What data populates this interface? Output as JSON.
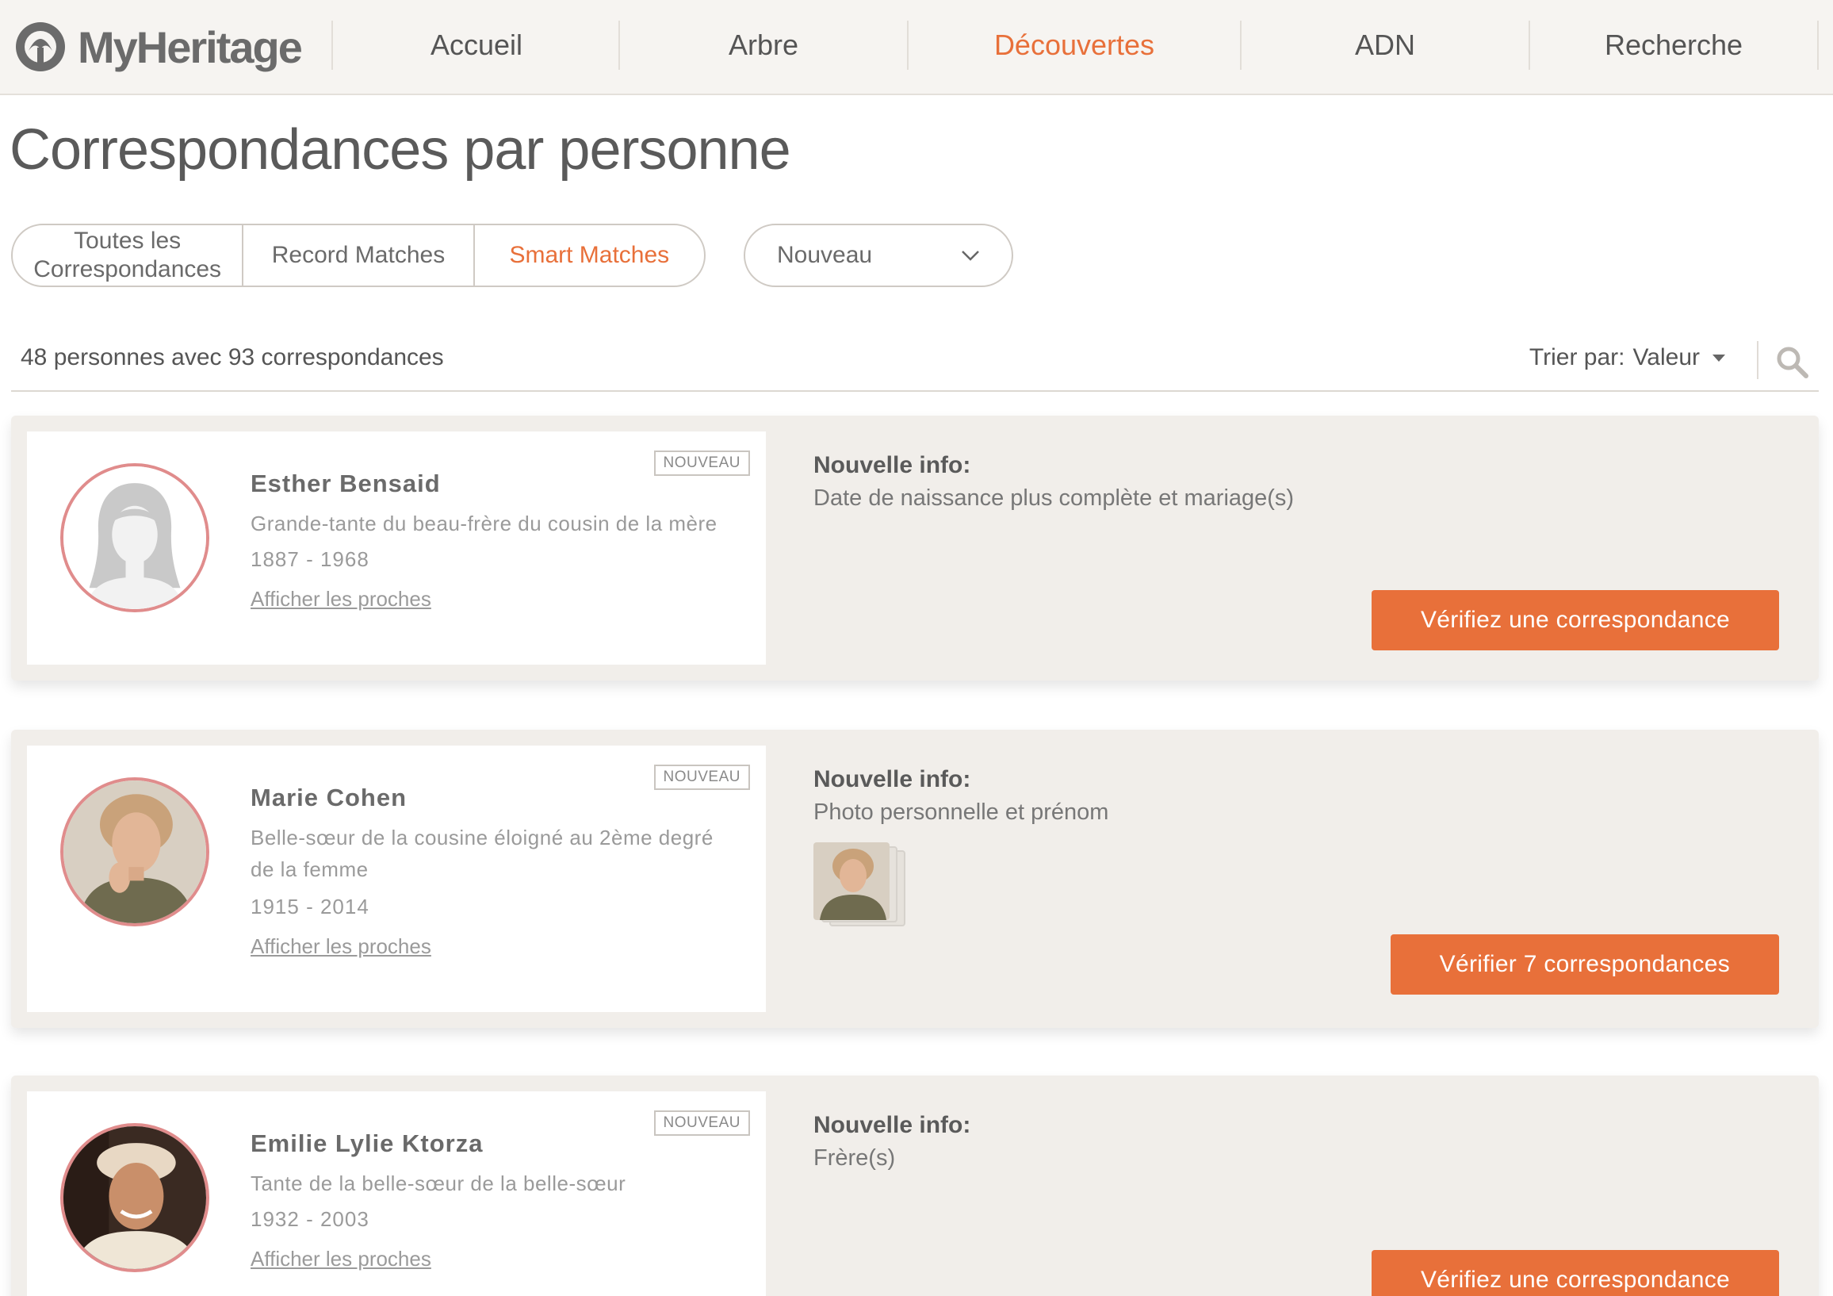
{
  "brand": {
    "name": "MyHeritage",
    "accent": "#e8703a"
  },
  "nav": {
    "items": [
      {
        "label": "Accueil",
        "active": false
      },
      {
        "label": "Arbre",
        "active": false
      },
      {
        "label": "Découvertes",
        "active": true
      },
      {
        "label": "ADN",
        "active": false
      },
      {
        "label": "Recherche",
        "active": false
      }
    ]
  },
  "page": {
    "title": "Correspondances par personne"
  },
  "filters": {
    "tabs": [
      {
        "label": "Toutes les\nCorrespondances",
        "active": false
      },
      {
        "label": "Record Matches",
        "active": false
      },
      {
        "label": "Smart Matches",
        "active": true
      }
    ],
    "status_dropdown": {
      "selected": "Nouveau",
      "icon": "chevron-down-icon"
    }
  },
  "results": {
    "summary": "48 personnes avec 93 correspondances",
    "sort_label": "Trier par:",
    "sort_value": "Valeur",
    "search_icon": "search-icon"
  },
  "matches": [
    {
      "name": "Esther Bensaid",
      "relation": "Grande-tante du beau-frère du cousin de la mère",
      "years": "1887 - 1968",
      "link": "Afficher les proches",
      "badge": "NOUVEAU",
      "avatar": "silhouette-female-icon",
      "info_title": "Nouvelle info:",
      "info_text": "Date de naissance plus complète et mariage(s)",
      "cta": "Vérifiez une correspondance"
    },
    {
      "name": "Marie Cohen",
      "relation": "Belle-sœur de la cousine éloigné au 2ème degré de la femme",
      "years": "1915 - 2014",
      "link": "Afficher les proches",
      "badge": "NOUVEAU",
      "avatar": "portrait-photo",
      "info_title": "Nouvelle info:",
      "info_text": "Photo personnelle et prénom",
      "cta": "Vérifier 7 correspondances"
    },
    {
      "name": "Emilie Lylie Ktorza",
      "relation": "Tante de la belle-sœur de la belle-sœur",
      "years": "1932 - 2003",
      "link": "Afficher les proches",
      "badge": "NOUVEAU",
      "avatar": "portrait-photo",
      "info_title": "Nouvelle info:",
      "info_text": "Frère(s)",
      "cta": "Vérifiez une correspondance"
    }
  ]
}
